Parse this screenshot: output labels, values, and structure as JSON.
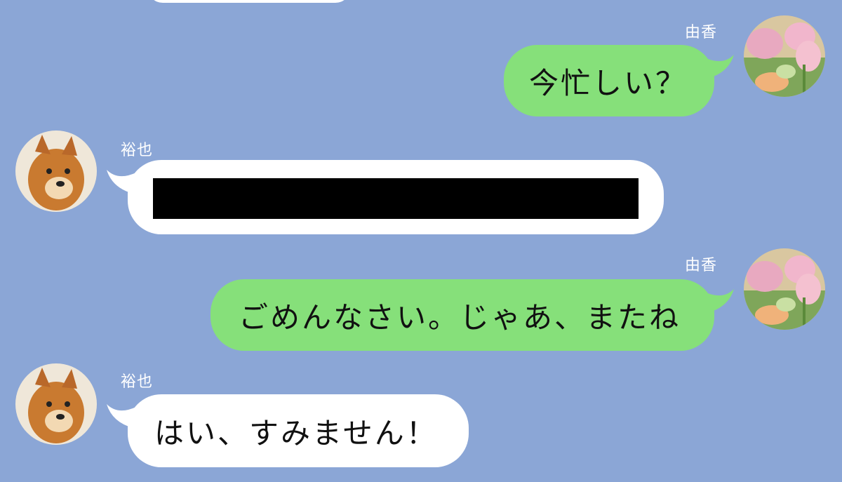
{
  "theme": {
    "background": "#8ba6d6",
    "outgoing_bubble": "#86e07a",
    "incoming_bubble": "#ffffff"
  },
  "contacts": {
    "self_name": "由香",
    "other_name": "裕也"
  },
  "messages": [
    {
      "sender": "由香",
      "direction": "outgoing",
      "text": "今忙しい？"
    },
    {
      "sender": "裕也",
      "direction": "incoming",
      "text": "",
      "redacted": true
    },
    {
      "sender": "由香",
      "direction": "outgoing",
      "text": "ごめんなさい。じゃあ、またね"
    },
    {
      "sender": "裕也",
      "direction": "incoming",
      "text": "はい、すみません！"
    }
  ],
  "avatars": {
    "self": "tulip-photo",
    "other": "shiba-dog-photo"
  }
}
